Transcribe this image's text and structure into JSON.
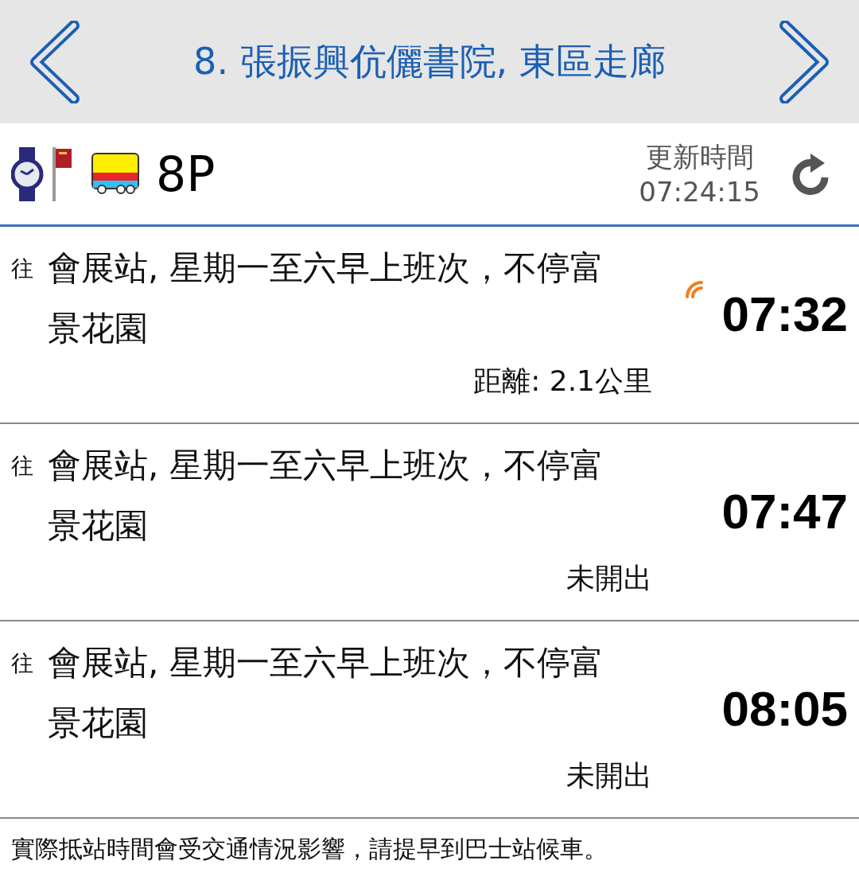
{
  "header": {
    "title": "8. 張振興伉儷書院, 東區走廊"
  },
  "route": {
    "number": "8P",
    "updated_label": "更新時間",
    "updated_time": "07:24:15"
  },
  "departures": [
    {
      "to_label": "往",
      "destination": "會展站, 星期一至六早上班次，不停富景花園",
      "time": "07:32",
      "realtime": true,
      "note": "距離: 2.1公里"
    },
    {
      "to_label": "往",
      "destination": "會展站, 星期一至六早上班次，不停富景花園",
      "time": "07:47",
      "realtime": false,
      "note": "未開出"
    },
    {
      "to_label": "往",
      "destination": "會展站, 星期一至六早上班次，不停富景花園",
      "time": "08:05",
      "realtime": false,
      "note": "未開出"
    }
  ],
  "footer": {
    "notice": "實際抵站時間會受交通情況影響，請提早到巴士站候車。"
  }
}
